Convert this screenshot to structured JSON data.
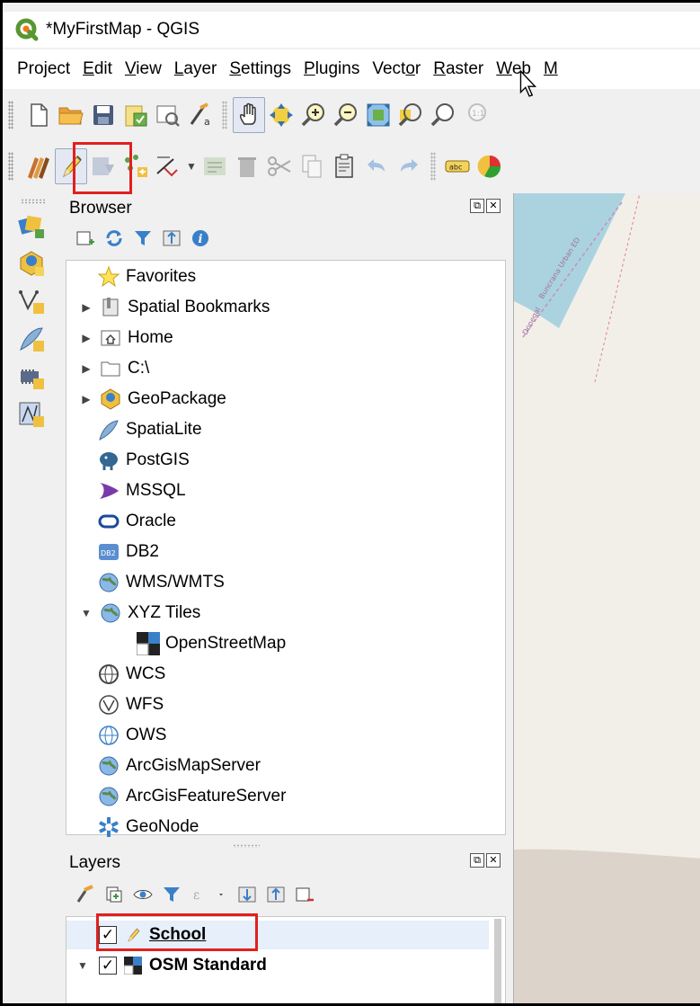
{
  "window": {
    "title": "*MyFirstMap - QGIS"
  },
  "menubar": [
    {
      "pre": "Pro",
      "u": "j",
      "post": "ect"
    },
    {
      "pre": "",
      "u": "E",
      "post": "dit"
    },
    {
      "pre": "",
      "u": "V",
      "post": "iew"
    },
    {
      "pre": "",
      "u": "L",
      "post": "ayer"
    },
    {
      "pre": "",
      "u": "S",
      "post": "ettings"
    },
    {
      "pre": "",
      "u": "P",
      "post": "lugins"
    },
    {
      "pre": "Vect",
      "u": "o",
      "post": "r"
    },
    {
      "pre": "",
      "u": "R",
      "post": "aster"
    },
    {
      "pre": "",
      "u": "W",
      "post": "eb"
    },
    {
      "pre": "",
      "u": "M",
      "post": ""
    }
  ],
  "browser": {
    "title": "Browser",
    "items": [
      {
        "label": "Favorites",
        "icon": "star-icon"
      },
      {
        "label": "Spatial Bookmarks",
        "icon": "bookmark-icon"
      },
      {
        "label": "Home",
        "icon": "home-folder-icon"
      },
      {
        "label": "C:\\",
        "icon": "drive-folder-icon"
      },
      {
        "label": "GeoPackage",
        "icon": "geopackage-icon"
      },
      {
        "label": "SpatiaLite",
        "icon": "spatialite-feather-icon"
      },
      {
        "label": "PostGIS",
        "icon": "postgis-elephant-icon"
      },
      {
        "label": "MSSQL",
        "icon": "mssql-icon"
      },
      {
        "label": "Oracle",
        "icon": "oracle-icon"
      },
      {
        "label": "DB2",
        "icon": "db2-icon"
      },
      {
        "label": "WMS/WMTS",
        "icon": "wms-globe-icon"
      },
      {
        "label": "XYZ Tiles",
        "icon": "xyz-globe-icon"
      },
      {
        "label": "OpenStreetMap",
        "icon": "tile-grid-icon"
      },
      {
        "label": "WCS",
        "icon": "wcs-globe-icon"
      },
      {
        "label": "WFS",
        "icon": "wfs-globe-icon"
      },
      {
        "label": "OWS",
        "icon": "ows-globe-icon"
      },
      {
        "label": "ArcGisMapServer",
        "icon": "arcgis-map-icon"
      },
      {
        "label": "ArcGisFeatureServer",
        "icon": "arcgis-feature-icon"
      },
      {
        "label": "GeoNode",
        "icon": "geonode-icon"
      }
    ],
    "float_label": "⧉",
    "close_label": "✕",
    "db2_badge": "DB2"
  },
  "layers": {
    "title": "Layers",
    "items": [
      {
        "name": "School",
        "checked": "✓",
        "icon": "pencil-edit-icon"
      },
      {
        "name": "OSM Standard",
        "checked": "✓",
        "icon": "tile-grid-icon"
      }
    ]
  },
  "map": {
    "labels": [
      "Donegal",
      "Buncrana Urban ED"
    ]
  },
  "colors": {
    "highlight": "#e02020",
    "selection": "#e6effa",
    "map_land": "#f2efe9",
    "map_water": "#aad3df"
  }
}
